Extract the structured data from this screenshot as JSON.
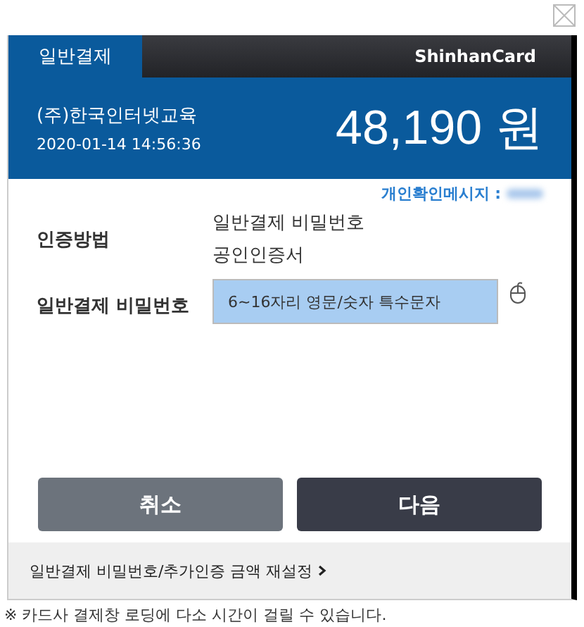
{
  "tabs": [
    {
      "label": "일반결제",
      "selected": true
    }
  ],
  "brand": "ShinhanCard",
  "merchant": "(주)한국인터넷교육",
  "datetime": "2020-01-14  14:56:36",
  "amount": "48,190 원",
  "personal_message": {
    "label": "개인확인메시지 :"
  },
  "auth_method": {
    "label": "인증방법",
    "options": [
      "일반결제 비밀번호",
      "공인인증서"
    ]
  },
  "password": {
    "label": "일반결제 비밀번호",
    "placeholder": "6~16자리 영문/숫자 특수문자"
  },
  "buttons": [
    {
      "label": "취소",
      "kind": "secondary"
    },
    {
      "label": "다음",
      "kind": "primary"
    }
  ],
  "reset_link": "일반결제 비밀번호/추가인증 금액 재설정",
  "note": "※ 카드사 결제창 로딩에 다소 시간이 걸릴 수 있습니다."
}
